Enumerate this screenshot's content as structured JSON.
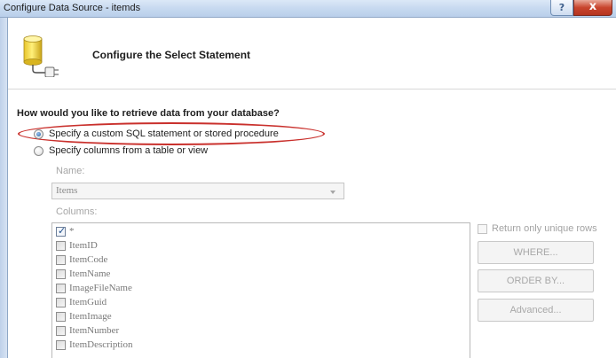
{
  "window": {
    "title": "Configure Data Source - itemds",
    "help_glyph": "?",
    "close_glyph": "x"
  },
  "header": {
    "title": "Configure the Select Statement",
    "icon": "database-icon"
  },
  "main": {
    "question": "How would you like to retrieve data from your database?",
    "options": [
      {
        "label": "Specify a custom SQL statement or stored procedure",
        "selected": true
      },
      {
        "label": "Specify columns from a table or view",
        "selected": false
      }
    ],
    "name_label": "Name:",
    "name_value": "Items",
    "columns_label": "Columns:",
    "columns": [
      {
        "name": "*",
        "checked": true
      },
      {
        "name": "ItemID",
        "checked": false
      },
      {
        "name": "ItemCode",
        "checked": false
      },
      {
        "name": "ItemName",
        "checked": false
      },
      {
        "name": "ImageFileName",
        "checked": false
      },
      {
        "name": "ItemGuid",
        "checked": false
      },
      {
        "name": "ItemImage",
        "checked": false
      },
      {
        "name": "ItemNumber",
        "checked": false
      },
      {
        "name": "ItemDescription",
        "checked": false
      }
    ],
    "unique_rows_label": "Return only unique rows",
    "buttons": {
      "where": "WHERE...",
      "order_by": "ORDER BY...",
      "advanced": "Advanced..."
    }
  },
  "colors": {
    "highlight": "#c9302c",
    "titlebar": "#c7d9f0",
    "close_button": "#c8452e"
  }
}
